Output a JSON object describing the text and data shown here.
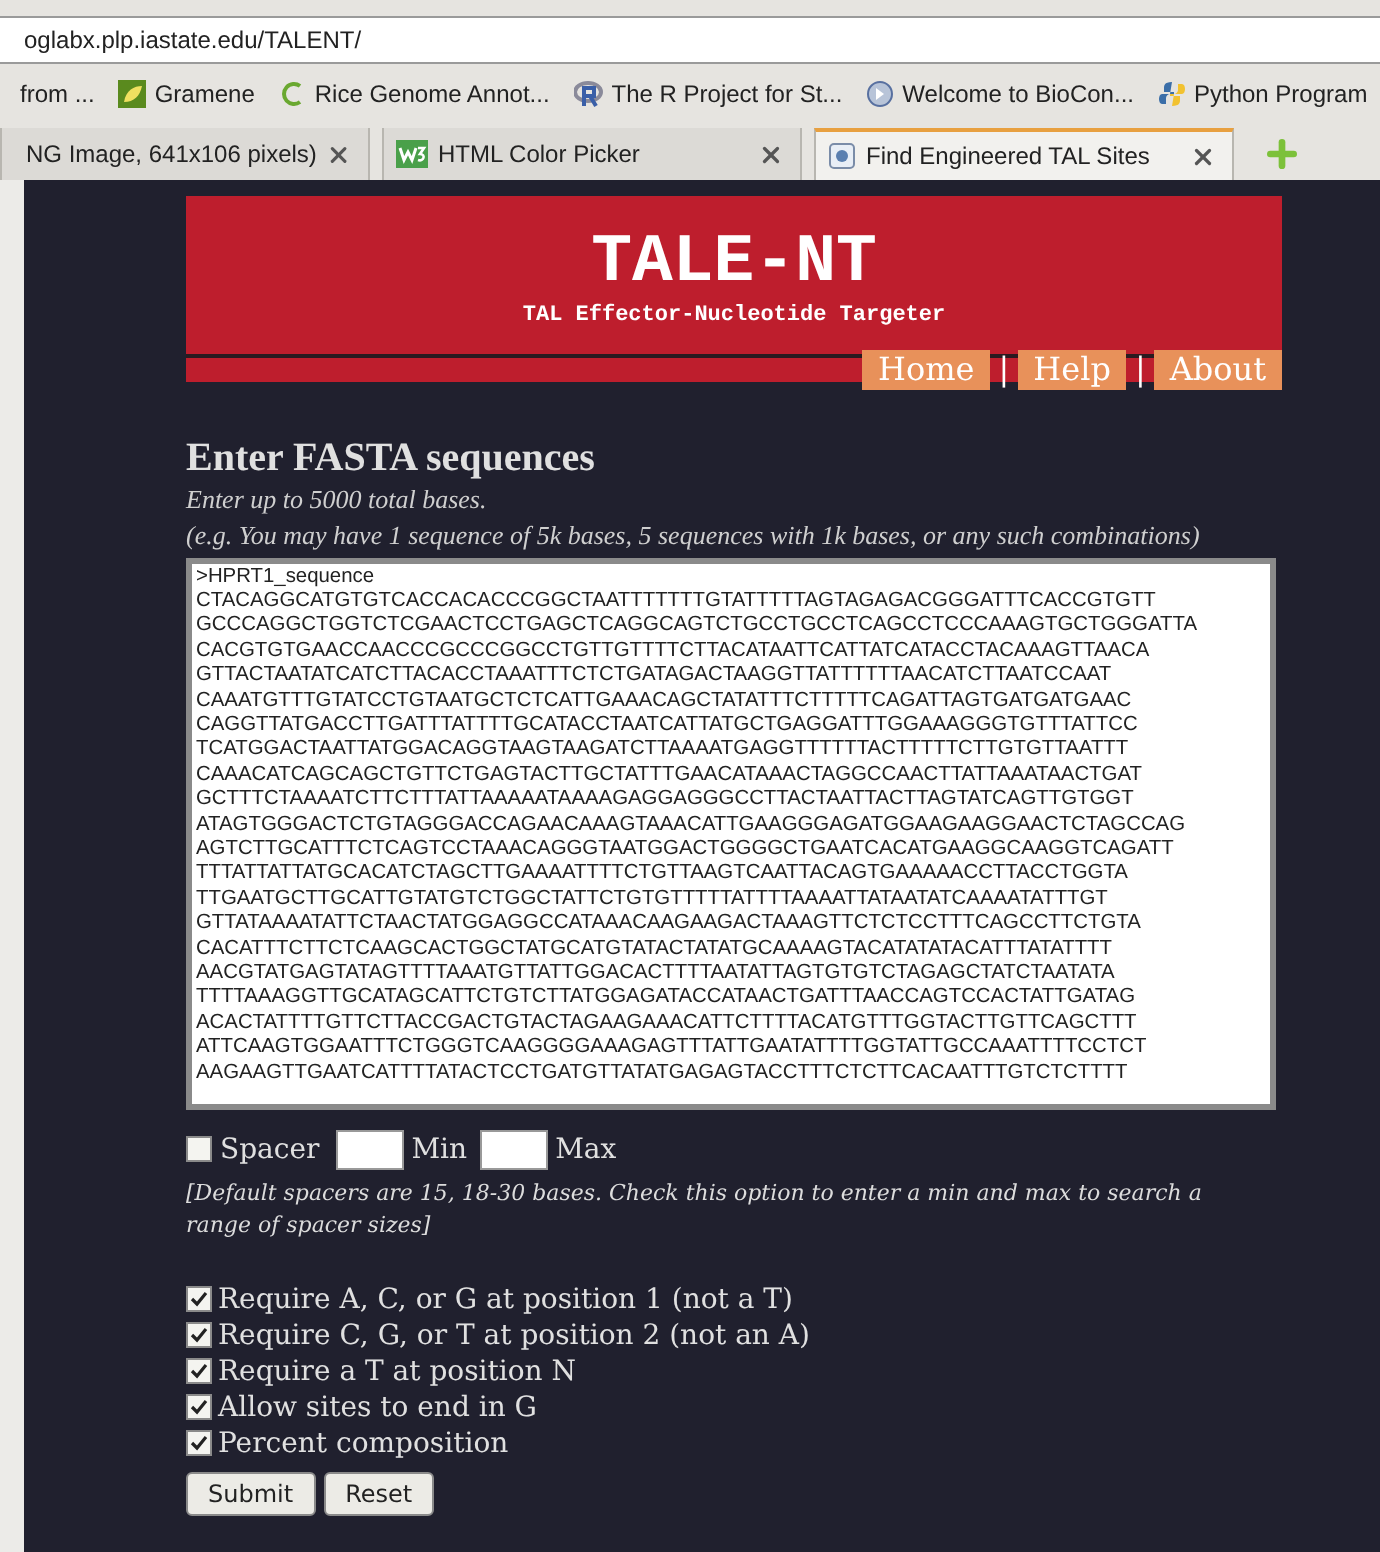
{
  "browser": {
    "url": "oglabx.plp.iastate.edu/TALENT/",
    "bookmarks": [
      {
        "kind": "none",
        "label": "from ..."
      },
      {
        "kind": "leaf",
        "label": "Gramene"
      },
      {
        "kind": "ring",
        "label": "Rice Genome Annot..."
      },
      {
        "kind": "r",
        "label": "The R Project for St..."
      },
      {
        "kind": "disc",
        "label": "Welcome to BioCon..."
      },
      {
        "kind": "snake",
        "label": "Python Program"
      }
    ],
    "tabs": [
      {
        "kind": "none",
        "label": "NG Image, 641x106 pixels)",
        "selected": false
      },
      {
        "kind": "w3",
        "label": "HTML Color Picker",
        "selected": false
      },
      {
        "kind": "page",
        "label": "Find Engineered TAL Sites",
        "selected": true
      }
    ]
  },
  "header": {
    "title": "TALE-NT",
    "subtitle": "TAL Effector-Nucleotide Targeter",
    "nav": [
      "Home",
      "Help",
      "About"
    ],
    "nav_separators": [
      "|",
      "|"
    ]
  },
  "form": {
    "heading": "Enter FASTA sequences",
    "hint": "Enter up to 5000 total bases.",
    "example": "(e.g. You may have 1 sequence of 5k bases, 5 sequences with 1k bases, or any such combinations)",
    "sequence": [
      ">HPRT1_sequence",
      "CTACAGGCATGTGTCACCACACCCGGCTAATTTTTTTGTATTTTTAGTAGAGACGGGATTTCACCGTGTT",
      "GCCCAGGCTGGTCTCGAACTCCTGAGCTCAGGCAGTCTGCCTGCCTCAGCCTCCCAAAGTGCTGGGATTA",
      "CACGTGTGAACCAACCCGCCCGGCCTGTTGTTTTCTTACATAATTCATTATCATACCTACAAAGTTAACA",
      "GTTACTAATATCATCTTACACCTAAATTTCTCTGATAGACTAAGGTTATTTTTTAACATCTTAATCCAAT",
      "CAAATGTTTGTATCCTGTAATGCTCTCATTGAAACAGCTATATTTCTTTTTCAGATTAGTGATGATGAAC",
      "CAGGTTATGACCTTGATTTATTTTGCATACCTAATCATTATGCTGAGGATTTGGAAAGGGTGTTTATTCC",
      "TCATGGACTAATTATGGACAGGTAAGTAAGATCTTAAAATGAGGTTTTTTACTTTTTCTTGTGTTAATTT",
      "CAAACATCAGCAGCTGTTCTGAGTACTTGCTATTTGAACATAAACTAGGCCAACTTATTAAATAACTGAT",
      "GCTTTCTAAAATCTTCTTTATTAAAAATAAAAGAGGAGGGCCTTACTAATTACTTAGTATCAGTTGTGGT",
      "ATAGTGGGACTCTGTAGGGACCAGAACAAAGTAAACATTGAAGGGAGATGGAAGAAGGAACTCTAGCCAG",
      "AGTCTTGCATTTCTCAGTCCTAAACAGGGTAATGGACTGGGGCTGAATCACATGAAGGCAAGGTCAGATT",
      "TTTATTATTATGCACATCTAGCTTGAAAATTTTCTGTTAAGTCAATTACAGTGAAAAACCTTACCTGGTA",
      "TTGAATGCTTGCATTGTATGTCTGGCTATTCTGTGTTTTTATTTTAAAATTATAATATCAAAATATTTGT",
      "GTTATAAAATATTCTAACTATGGAGGCCATAAACAAGAAGACTAAAGTTCTCTCCTTTCAGCCTTCTGTA",
      "CACATTTCTTCTCAAGCACTGGCTATGCATGTATACTATATGCAAAAGTACATATATACATTTATATTTT",
      "AACGTATGAGTATAGTTTTAAATGTTATTGGACACTTTTAATATTAGTGTGTCTAGAGCTATCTAATATA",
      "TTTTAAAGGTTGCATAGCATTCTGTCTTATGGAGATACCATAACTGATTTAACCAGTCCACTATTGATAG",
      "ACACTATTTTGTTCTTACCGACTGTACTAGAAGAAACATTCTTTTACATGTTTGGTACTTGTTCAGCTTT",
      "ATTCAAGTGGAATTTCTGGGTCAAGGGGAAAGAGTTTATTGAATATTTTGGTATTGCCAAATTTTCCTCT",
      "AAGAAGTTGAATCATTTTATACTCCTGATGTTATATGAGAGTACCTTTCTCTTCACAATTTGTCTCTTTT"
    ],
    "spacer": {
      "label": "Spacer",
      "checked": false,
      "min_label": "Min",
      "max_label": "Max"
    },
    "spacer_note": "[Default spacers are 15, 18-30 bases. Check this option to enter a min and max to search a range of spacer sizes]",
    "options": [
      {
        "label": "Require A, C, or G at position 1 (not a T)",
        "checked": true
      },
      {
        "label": "Require C, G, or T at position 2 (not an A)",
        "checked": true
      },
      {
        "label": "Require a T at position N",
        "checked": true
      },
      {
        "label": "Allow sites to end in G",
        "checked": true
      },
      {
        "label": "Percent composition",
        "checked": true
      }
    ],
    "buttons": [
      "Submit",
      "Reset"
    ]
  }
}
